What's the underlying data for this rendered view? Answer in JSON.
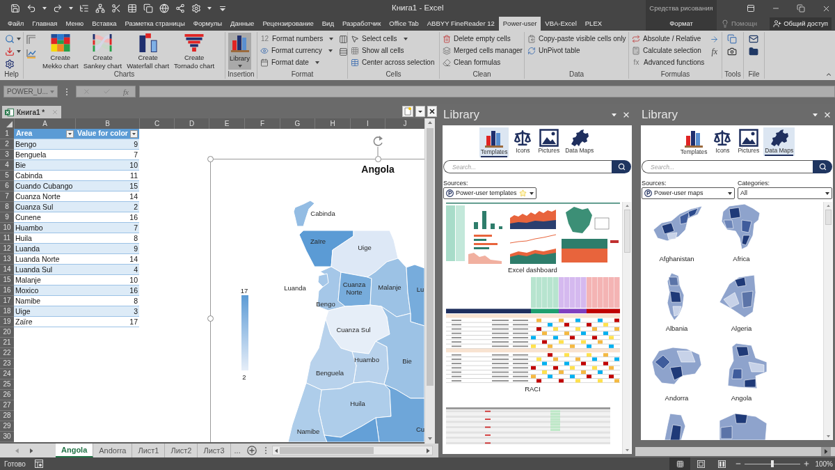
{
  "title_bar": {
    "title": "Книга1 - Excel"
  },
  "menu_tabs": [
    {
      "label": "Файл",
      "selected": false
    },
    {
      "label": "Главная",
      "selected": false
    },
    {
      "label": "Меню",
      "selected": false
    },
    {
      "label": "Вставка",
      "selected": false
    },
    {
      "label": "Разметка страницы",
      "selected": false
    },
    {
      "label": "Формулы",
      "selected": false
    },
    {
      "label": "Данные",
      "selected": false
    },
    {
      "label": "Рецензирование",
      "selected": false
    },
    {
      "label": "Вид",
      "selected": false
    },
    {
      "label": "Разработчик",
      "selected": false
    },
    {
      "label": "Office Tab",
      "selected": false
    },
    {
      "label": "ABBYY FineReader 12",
      "selected": false
    },
    {
      "label": "Power-user",
      "selected": true
    },
    {
      "label": "VBA-Excel",
      "selected": false
    },
    {
      "label": "PLEX",
      "selected": false
    }
  ],
  "context_tabs": {
    "title": "Средства рисования",
    "tabs": [
      {
        "label": "Формат",
        "selected": false
      }
    ]
  },
  "tell_me": "Помощн",
  "share": "Общий доступ",
  "ribbon": {
    "groups": [
      {
        "label": "Help",
        "kind": "icons"
      },
      {
        "label": "Charts",
        "kind": "large",
        "buttons": [
          {
            "lines": [
              "Create",
              "Mekko chart"
            ],
            "dropdown": false
          },
          {
            "lines": [
              "Create",
              "Sankey chart"
            ],
            "dropdown": false
          },
          {
            "lines": [
              "Create",
              "Waterfall chart"
            ],
            "dropdown": false
          },
          {
            "lines": [
              "Create",
              "Tornado chart"
            ],
            "dropdown": false
          }
        ]
      },
      {
        "label": "Insertion",
        "kind": "large",
        "buttons": [
          {
            "lines": [
              "Library"
            ],
            "dropdown": true,
            "highlighted": true
          }
        ]
      },
      {
        "label": "Format",
        "kind": "list",
        "items": [
          {
            "icon_text": "12",
            "label": "Format numbers",
            "dropdown": true
          },
          {
            "label": "Format currency",
            "dropdown": true
          },
          {
            "label": "Format date",
            "dropdown": true
          }
        ]
      },
      {
        "label": "Cells",
        "kind": "list",
        "items": [
          {
            "label": "Select cells",
            "dropdown": true
          },
          {
            "label": "Show all cells",
            "dropdown": false
          },
          {
            "label": "Center across selection",
            "dropdown": false
          }
        ]
      },
      {
        "label": "Clean",
        "kind": "list",
        "items": [
          {
            "label": "Delete empty cells",
            "dropdown": false
          },
          {
            "label": "Merged cells manager",
            "dropdown": false
          },
          {
            "label": "Clean formulas",
            "dropdown": false
          }
        ]
      },
      {
        "label": "Data",
        "kind": "list",
        "items": [
          {
            "label": "Copy-paste visible cells only",
            "dropdown": false
          },
          {
            "label": "UnPivot table",
            "dropdown": false
          }
        ]
      },
      {
        "label": "Formulas",
        "kind": "list",
        "side_text": "fx",
        "items": [
          {
            "label": "Absolute / Relative",
            "dropdown": false
          },
          {
            "label": "Calculate selection",
            "dropdown": false
          },
          {
            "icon_text": "fx",
            "label": "Advanced functions",
            "dropdown": false
          }
        ]
      },
      {
        "label": "Tools",
        "kind": "icons"
      },
      {
        "label": "File",
        "kind": "icons"
      }
    ]
  },
  "formula_bar": {
    "name_box": "POWER_U...",
    "function_button": "fx"
  },
  "document_tab": "Книга1 *",
  "sheet": {
    "columns": [
      "A",
      "B",
      "C",
      "D",
      "E",
      "F",
      "G",
      "H",
      "I",
      "J"
    ],
    "row_numbers": [
      "1",
      "2",
      "3",
      "4",
      "5",
      "6",
      "7",
      "8",
      "9",
      "10",
      "11",
      "12",
      "13",
      "14",
      "15",
      "16",
      "17",
      "18",
      "19",
      "20",
      "21",
      "22",
      "23",
      "24",
      "25",
      "26",
      "27",
      "28",
      "29",
      "30"
    ],
    "table": {
      "headers": [
        "Area",
        "Value for color"
      ],
      "rows": [
        [
          "Bengo",
          "9"
        ],
        [
          "Benguela",
          "7"
        ],
        [
          "Bie",
          "10"
        ],
        [
          "Cabinda",
          "11"
        ],
        [
          "Cuando Cubango",
          "15"
        ],
        [
          "Cuanza Norte",
          "14"
        ],
        [
          "Cuanza Sul",
          "2"
        ],
        [
          "Cunene",
          "16"
        ],
        [
          "Huambo",
          "7"
        ],
        [
          "Huila",
          "8"
        ],
        [
          "Luanda",
          "9"
        ],
        [
          "Luanda Norte",
          "14"
        ],
        [
          "Luanda Sul",
          "4"
        ],
        [
          "Malanje",
          "10"
        ],
        [
          "Moxico",
          "16"
        ],
        [
          "Namibe",
          "8"
        ],
        [
          "Uige",
          "3"
        ],
        [
          "Zaïre",
          "17"
        ]
      ]
    },
    "chart": {
      "title": "Angola",
      "legend_max": "17",
      "legend_min": "2",
      "regions": [
        {
          "label": "Cabinda",
          "color": "#93bce3"
        },
        {
          "label": "Zaïre",
          "color": "#5b9bd5"
        },
        {
          "label": "Uige",
          "color": "#dde8f6"
        },
        {
          "label": "Bengo",
          "color": "#a5c7e8"
        },
        {
          "label": "Luanda",
          "color": "#a5c7e8"
        },
        {
          "label": "Cuanza Norte",
          "color": "#77acdc"
        },
        {
          "label": "Malanje",
          "color": "#9cc2e5"
        },
        {
          "label": "Lu",
          "color": "#77acdc"
        },
        {
          "label": "Cuanza Sul",
          "color": "#e6eef8"
        },
        {
          "label": "Huambo",
          "color": "#b8d2ec"
        },
        {
          "label": "Bie",
          "color": "#9cc2e5"
        },
        {
          "label": "Benguela",
          "color": "#b8d2ec"
        },
        {
          "label": "Huila",
          "color": "#aecdea"
        },
        {
          "label": "Namibe",
          "color": "#aecdea"
        },
        {
          "label": "Cu",
          "color": "#6ea6d9"
        },
        {
          "color": "#64a0d7"
        }
      ]
    }
  },
  "sheet_tabs": [
    {
      "label": "Angola",
      "selected": true
    },
    {
      "label": "Andorra",
      "selected": false
    },
    {
      "label": "Лист1",
      "selected": false
    },
    {
      "label": "Лист2",
      "selected": false
    },
    {
      "label": "Лист3",
      "selected": false
    }
  ],
  "more_sheets": "...",
  "status_bar": {
    "text": "Готово",
    "views": [
      {
        "kind": "normal",
        "selected": true
      },
      {
        "kind": "page_layout",
        "selected": false
      },
      {
        "kind": "page_break",
        "selected": false
      }
    ],
    "zoom_slider": {
      "level": 0.5
    },
    "zoom": "100%"
  },
  "library_panels": [
    {
      "title": "Library",
      "kind": "templates",
      "tabs": [
        {
          "label": "Templates",
          "selected": true
        },
        {
          "label": "Icons",
          "selected": false
        },
        {
          "label": "Pictures",
          "selected": false
        },
        {
          "label": "Data Maps",
          "selected": false
        }
      ],
      "search_placeholder": "Search...",
      "filters": [
        {
          "label": "Sources:",
          "value": "Power-user templates",
          "logo": true,
          "starred": true
        }
      ],
      "items": [
        {
          "kind": "dashboard",
          "caption": "Excel dashboard"
        },
        {
          "kind": "raci",
          "caption": "RACI"
        }
      ]
    },
    {
      "title": "Library",
      "kind": "maps",
      "tabs": [
        {
          "label": "Templates",
          "selected": false
        },
        {
          "label": "Icons",
          "selected": false
        },
        {
          "label": "Pictures",
          "selected": false
        },
        {
          "label": "Data Maps",
          "selected": true
        }
      ],
      "search_placeholder": "Search...",
      "filters": [
        {
          "label": "Sources:",
          "value": "Power-user maps",
          "logo": true,
          "starred": false
        },
        {
          "label": "Categories:",
          "value": "All",
          "logo": false,
          "starred": false
        }
      ],
      "items": [
        {
          "caption": "Afghanistan"
        },
        {
          "caption": "Africa"
        },
        {
          "caption": "Albania"
        },
        {
          "caption": "Algeria"
        },
        {
          "caption": "Andorra"
        },
        {
          "caption": "Angola"
        }
      ]
    }
  ]
}
